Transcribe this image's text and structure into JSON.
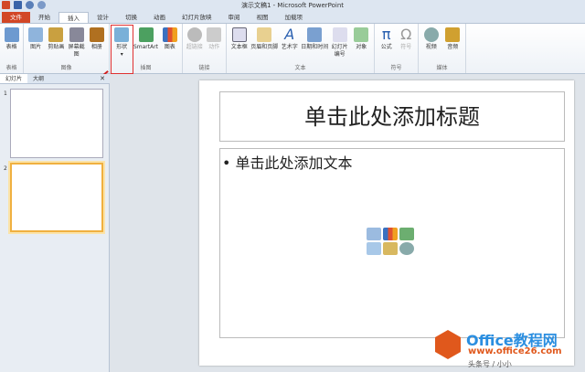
{
  "window": {
    "title": "演示文稿1 - Microsoft PowerPoint"
  },
  "tabs": [
    "文件",
    "开始",
    "插入",
    "设计",
    "切换",
    "动画",
    "幻灯片放映",
    "审阅",
    "视图",
    "加载项"
  ],
  "ribbon": {
    "groups": [
      {
        "label": "表格",
        "buttons": [
          "表格"
        ]
      },
      {
        "label": "图像",
        "buttons": [
          "图片",
          "剪贴画",
          "屏幕截图",
          "相册"
        ]
      },
      {
        "label": "插图",
        "buttons": [
          "形状",
          "SmartArt",
          "图表"
        ]
      },
      {
        "label": "链接",
        "buttons": [
          "超链接",
          "动作"
        ]
      },
      {
        "label": "文本",
        "buttons": [
          "文本框",
          "页眉和页脚",
          "艺术字",
          "日期和时间",
          "幻灯片编号",
          "对象"
        ]
      },
      {
        "label": "符号",
        "buttons": [
          "公式",
          "符号"
        ]
      },
      {
        "label": "媒体",
        "buttons": [
          "视频",
          "音频"
        ]
      }
    ]
  },
  "panel": {
    "tabs": [
      "幻灯片",
      "大纲"
    ],
    "close": "✕",
    "slides": [
      "1",
      "2"
    ]
  },
  "slide": {
    "title_placeholder": "单击此处添加标题",
    "body_placeholder": "单击此处添加文本",
    "bullet": "•"
  },
  "watermark": {
    "brand": "Office教程网",
    "url": "www.office26.com",
    "source": "头条号 / 小小"
  }
}
